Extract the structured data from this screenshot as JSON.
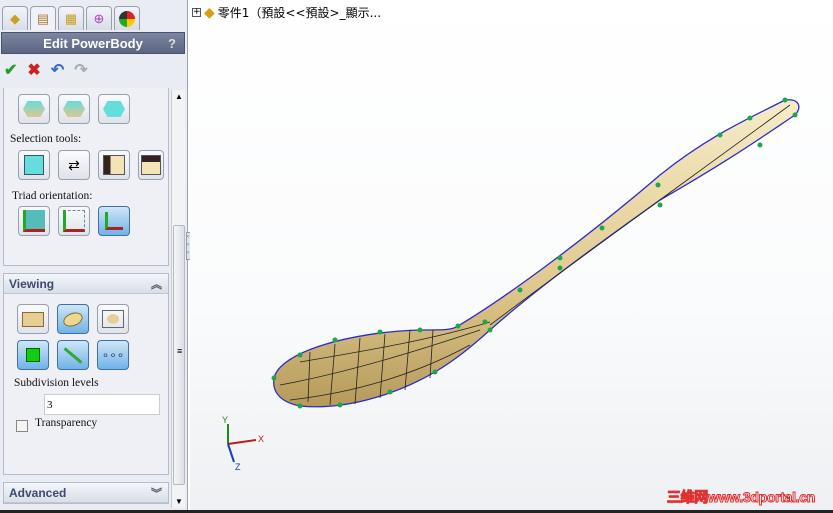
{
  "panel": {
    "tabs": [
      "feature-manager",
      "property-manager",
      "configuration-manager",
      "dimxpert-manager",
      "display-manager"
    ],
    "title": "Edit PowerBody",
    "help": "?",
    "actions": {
      "ok": "✔",
      "cancel": "✖",
      "undo": "↶",
      "redo": "↷"
    },
    "selection_tools_label": "Selection tools:",
    "triad_label": "Triad orientation:",
    "viewing": {
      "header": "Viewing",
      "subdivision_label": "Subdivision levels",
      "subdivision_value": "3",
      "transparency_label": "Transparency",
      "transparency_checked": false
    },
    "advanced": {
      "header": "Advanced"
    }
  },
  "viewport": {
    "tree_label": "零件1（預設<<預設>_顯示...",
    "watermark": "三维网www.3dportal.cn",
    "triad": {
      "x": "X",
      "y": "Y",
      "z": "Z"
    }
  }
}
